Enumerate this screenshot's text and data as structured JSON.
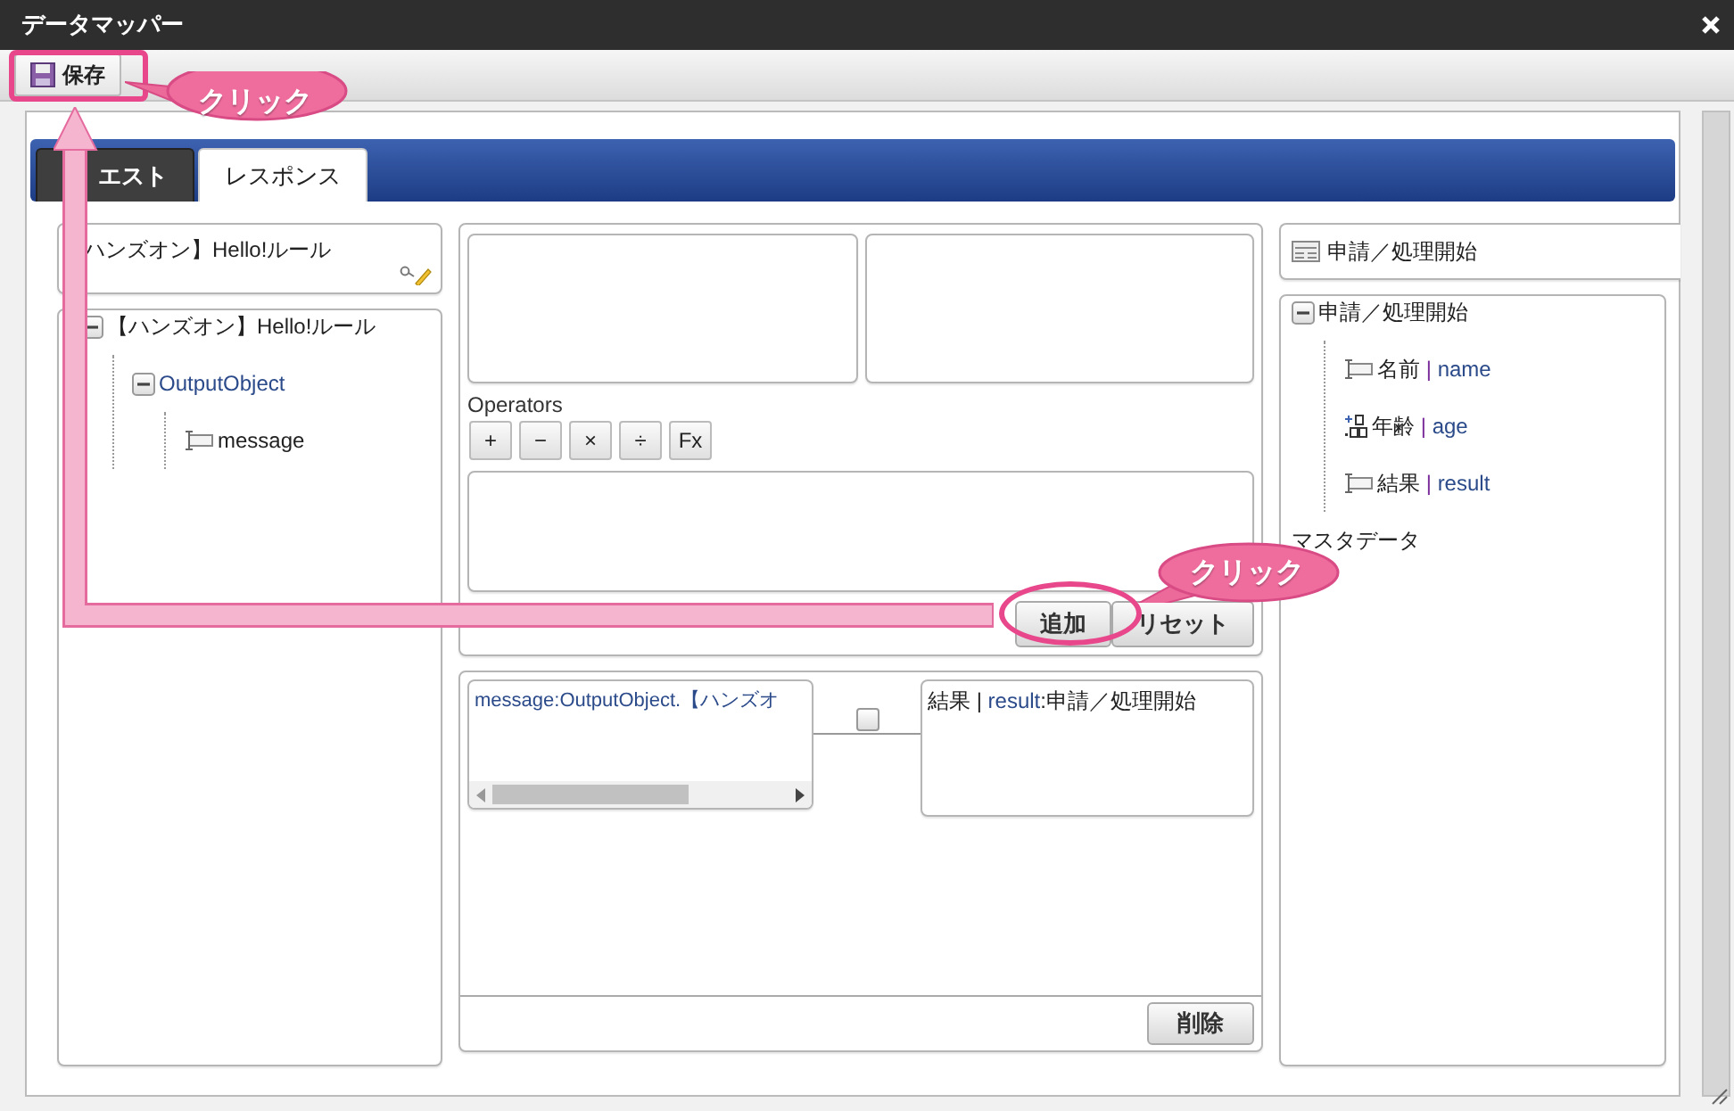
{
  "window": {
    "title": "データマッパー"
  },
  "toolbar": {
    "save": "保存"
  },
  "tabs": [
    {
      "label": "エスト",
      "selected": false
    },
    {
      "label": "レスポンス",
      "selected": true
    }
  ],
  "source": {
    "rule_name": "ハンズオン】Hello!ルール",
    "tree": [
      {
        "label": "【ハンズオン】Hello!ルール",
        "expanded": true,
        "children": [
          {
            "label": "OutputObject",
            "expanded": true,
            "children": [
              {
                "label": "message",
                "kind": "text"
              }
            ]
          }
        ]
      }
    ]
  },
  "editor": {
    "operators_label": "Operators",
    "operators": [
      "+",
      "−",
      "×",
      "÷",
      "Fx"
    ],
    "add": "追加",
    "reset": "リセット"
  },
  "mapping": {
    "source": "message:OutputObject.【ハンズオ",
    "target_label": "結果 | ",
    "target_field": "result",
    "target_rest": ":申請／処理開始",
    "checked": false,
    "delete": "削除"
  },
  "target": {
    "header": "申請／処理開始",
    "tree": [
      {
        "label": "申請／処理開始",
        "expanded": true,
        "children": [
          {
            "label": "名前",
            "separator": "|",
            "field": "name",
            "kind": "text"
          },
          {
            "label": "年齢",
            "separator": "|",
            "field": "age",
            "kind": "number"
          },
          {
            "label": "結果",
            "separator": "|",
            "field": "result",
            "kind": "text"
          }
        ]
      },
      {
        "label": "マスタデータ"
      }
    ]
  },
  "annotations": [
    {
      "text": "クリック"
    },
    {
      "text": "クリック"
    }
  ]
}
